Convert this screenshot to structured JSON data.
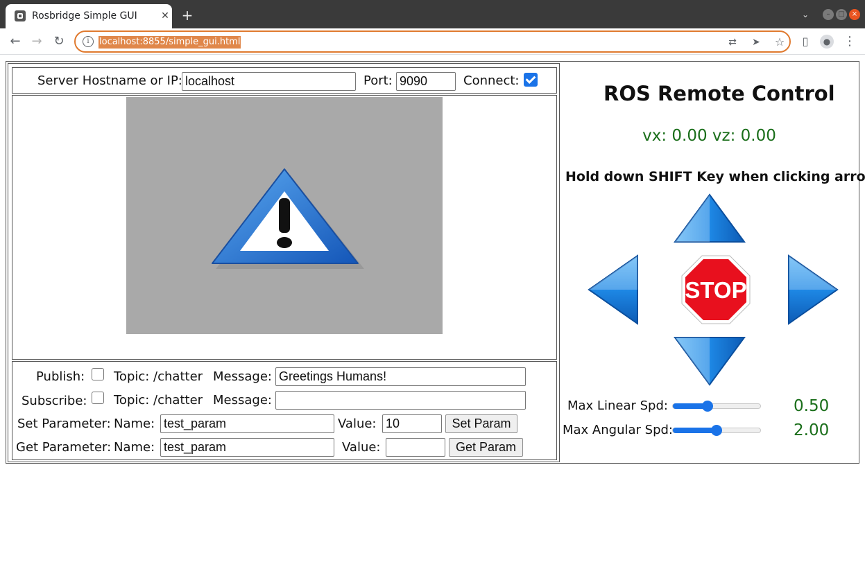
{
  "browser": {
    "tab_title": "Rosbridge Simple GUI",
    "tab_close": "✕",
    "new_tab": "+",
    "url": "localhost:8855/simple_gui.html"
  },
  "connection": {
    "host_label": "Server Hostname or IP:",
    "host_value": "localhost",
    "port_label": "Port:",
    "port_value": "9090",
    "connect_label": "Connect:",
    "connect_checked": true
  },
  "pubsub": {
    "publish_label": "Publish:",
    "publish_checked": false,
    "publish_topic": "Topic: /chatter",
    "publish_message_label": "Message:",
    "publish_message_value": "Greetings Humans!",
    "subscribe_label": "Subscribe:",
    "subscribe_checked": false,
    "subscribe_topic": "Topic: /chatter",
    "subscribe_message_label": "Message:",
    "subscribe_message_value": ""
  },
  "params": {
    "set_label": "Set Parameter:",
    "set_name_label": "Name:",
    "set_name_value": "test_param",
    "set_value_label": "Value:",
    "set_value_value": "10",
    "set_button": "Set Param",
    "get_label": "Get Parameter:",
    "get_name_label": "Name:",
    "get_name_value": "test_param",
    "get_value_label": "Value:",
    "get_value_value": "",
    "get_button": "Get Param"
  },
  "remote": {
    "title": "ROS Remote Control",
    "velocity": "vx: 0.00 vz: 0.00",
    "hint": "Hold down SHIFT Key when clicking arrows",
    "stop_label": "STOP",
    "max_linear_label": "Max Linear Spd:",
    "max_linear_value": "0.50",
    "max_linear_fraction": 0.4,
    "max_angular_label": "Max Angular Spd:",
    "max_angular_value": "2.00",
    "max_angular_fraction": 0.5
  },
  "colors": {
    "arrow_blue": "#1e88e5",
    "stop_red": "#e8101e",
    "value_green": "#1a6e1a",
    "accent": "#1a73e8"
  }
}
